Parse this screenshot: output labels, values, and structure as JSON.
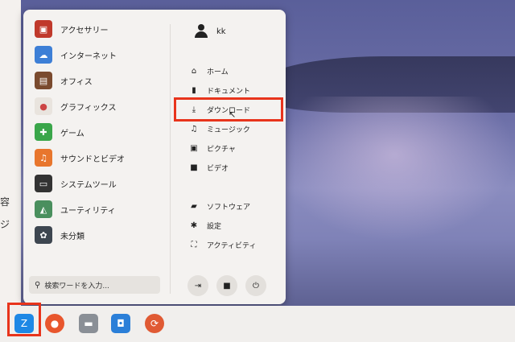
{
  "left_strip": {
    "chars": [
      "容",
      "ジ"
    ]
  },
  "menu": {
    "categories": [
      {
        "label": "アクセサリー",
        "icon": "toolbox-icon",
        "color": "#c0392b"
      },
      {
        "label": "インターネット",
        "icon": "cloud-icon",
        "color": "#3d7fd6"
      },
      {
        "label": "オフィス",
        "icon": "briefcase-icon",
        "color": "#7a4a2e"
      },
      {
        "label": "グラフィックス",
        "icon": "palette-icon",
        "color": "#e9e4de"
      },
      {
        "label": "ゲーム",
        "icon": "gamepad-icon",
        "color": "#3aa64a"
      },
      {
        "label": "サウンドとビデオ",
        "icon": "music-video-icon",
        "color": "#e8762d"
      },
      {
        "label": "システムツール",
        "icon": "monitor-icon",
        "color": "#333333"
      },
      {
        "label": "ユーティリティ",
        "icon": "map-icon",
        "color": "#4a8f5e"
      },
      {
        "label": "未分類",
        "icon": "gear-icon",
        "color": "#3d4650"
      }
    ],
    "search": {
      "placeholder": "検索ワードを入力..."
    },
    "user": {
      "name": "kk"
    },
    "places": [
      {
        "label": "ホーム",
        "icon": "home-icon"
      },
      {
        "label": "ドキュメント",
        "icon": "document-icon"
      },
      {
        "label": "ダウンロード",
        "icon": "download-icon"
      },
      {
        "label": "ミュージック",
        "icon": "music-icon"
      },
      {
        "label": "ピクチャ",
        "icon": "image-icon"
      },
      {
        "label": "ビデオ",
        "icon": "video-icon"
      }
    ],
    "system": [
      {
        "label": "ソフトウェア",
        "icon": "bag-icon"
      },
      {
        "label": "設定",
        "icon": "settings-icon"
      },
      {
        "label": "アクティビティ",
        "icon": "activities-icon"
      }
    ],
    "buttons": [
      "logout-icon",
      "lock-icon",
      "power-icon"
    ]
  },
  "taskbar": {
    "items": [
      {
        "name": "zorin-menu-button",
        "icon": "zorin-logo-icon",
        "color": "#1e88e5"
      },
      {
        "name": "firefox-button",
        "icon": "firefox-icon",
        "color": "#e8562d"
      },
      {
        "name": "files-button",
        "icon": "folder-icon",
        "color": "#8a8f96"
      },
      {
        "name": "software-button",
        "icon": "store-icon",
        "color": "#2b7fd8"
      },
      {
        "name": "update-button",
        "icon": "sync-icon",
        "color": "#e05a34"
      }
    ]
  }
}
